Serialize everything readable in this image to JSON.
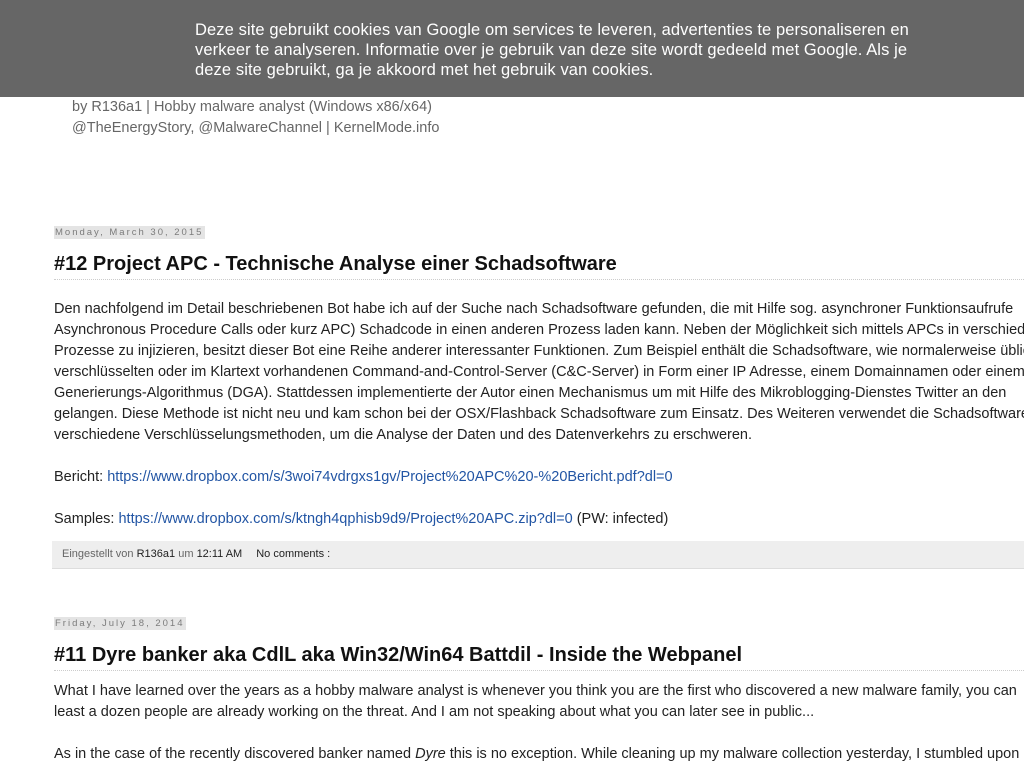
{
  "cookie_banner": {
    "line1": "Deze site gebruikt cookies van Google om services te leveren, advertenties te personaliseren en",
    "line2": "verkeer te analyseren. Informatie over je gebruik van deze site wordt gedeeld met Google. Als je",
    "line3": "deze site gebruikt, ga je akkoord met het gebruik van cookies."
  },
  "header": {
    "line1": "by R136a1 | Hobby malware analyst (Windows x86/x64)",
    "line2": "@TheEnergyStory, @MalwareChannel | KernelMode.info"
  },
  "posts": [
    {
      "date": "Monday, March 30, 2015",
      "title": "#12 Project APC - Technische Analyse einer Schadsoftware",
      "body_lines": [
        "Den nachfolgend im Detail beschriebenen Bot habe ich auf der Suche nach Schadsoftware gefunden, die mit Hilfe sog. asynchroner Funktionsaufrufe",
        "Asynchronous Procedure Calls oder kurz APC) Schadcode in einen anderen Prozess laden kann. Neben der Möglichkeit sich mittels APCs in verschiedene",
        "Prozesse zu injizieren, besitzt dieser Bot eine Reihe anderer interessanter Funktionen. Zum Beispiel enthält die Schadsoftware, wie normalerweise üblich,",
        "verschlüsselten oder im Klartext vorhandenen Command-and-Control-Server (C&C-Server) in Form einer IP Adresse, einem Domainnamen oder einem",
        "Generierungs-Algorithmus (DGA). Stattdessen implementierte der Autor einen Mechanismus um mit Hilfe des Mikroblogging-Dienstes Twitter an den",
        "gelangen. Diese Methode ist nicht neu und kam schon bei der OSX/Flashback Schadsoftware zum Einsatz. Des Weiteren verwendet die Schadsoftware",
        "verschiedene Verschlüsselungsmethoden, um die Analyse der Daten und des Datenverkehrs zu erschweren."
      ],
      "report_label": "Bericht: ",
      "report_link": "https://www.dropbox.com/s/3woi74vdrgxs1gv/Project%20APC%20-%20Bericht.pdf?dl=0",
      "samples_label": "Samples: ",
      "samples_link": "https://www.dropbox.com/s/ktngh4qphisb9d9/Project%20APC.zip?dl=0",
      "samples_suffix": " (PW: infected)",
      "footer": {
        "posted_by": "Eingestellt von ",
        "author": "R136a1",
        "at": " um ",
        "time": "12:11 AM",
        "comments": "No comments :"
      }
    },
    {
      "date": "Friday, July 18, 2014",
      "title": "#11 Dyre banker aka CdlL aka Win32/Win64 Battdil - Inside the Webpanel",
      "body_lines": [
        "What I have learned over the years as a hobby malware analyst is whenever you think you are the first who discovered a new malware family, you can",
        "least a dozen people are already working on the threat. And I am not speaking about what you can later see in public..."
      ],
      "p2_before": "As in the case of the recently discovered banker named ",
      "p2_italic": "Dyre",
      "p2_after": " this is no exception. While cleaning up my malware collection yesterday, I stumbled upon"
    }
  ]
}
